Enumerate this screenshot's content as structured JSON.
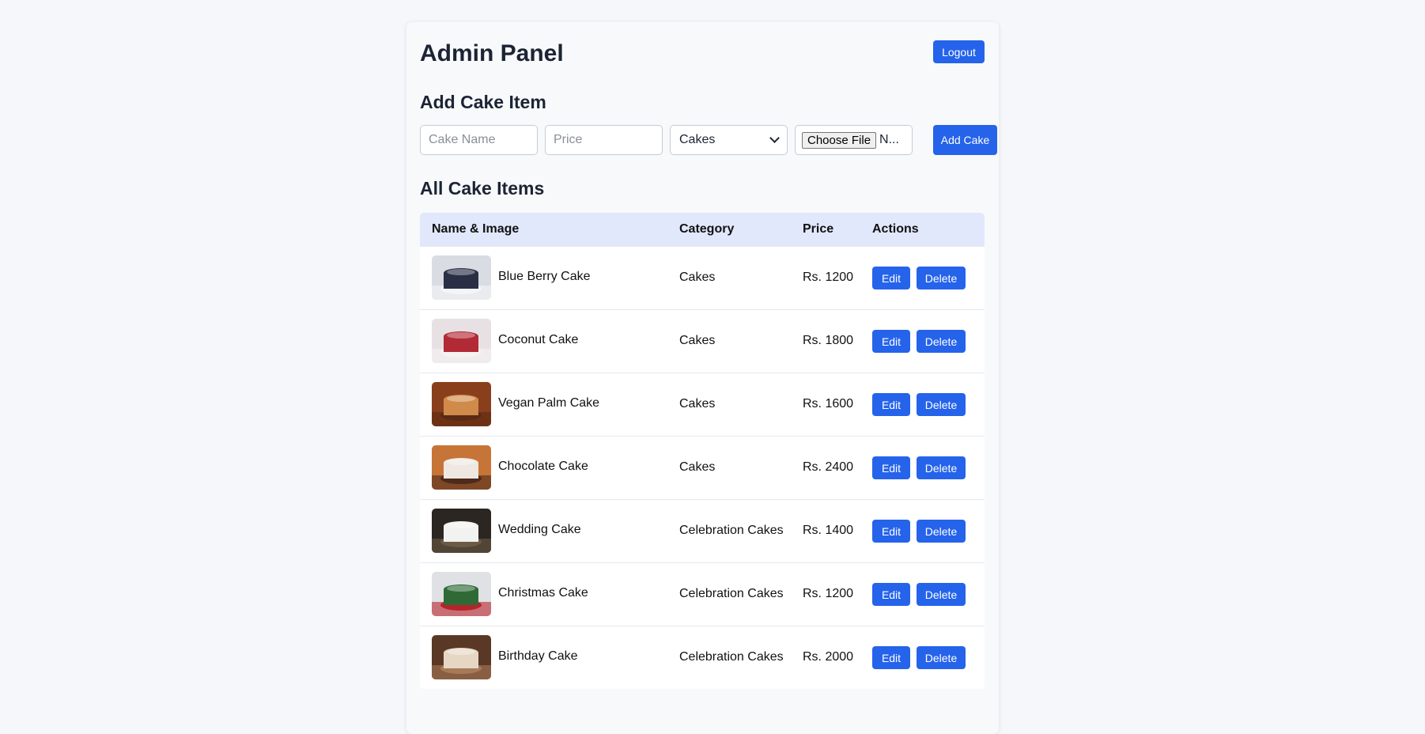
{
  "header": {
    "title": "Admin Panel",
    "logout_label": "Logout"
  },
  "add_form": {
    "title": "Add Cake Item",
    "name_placeholder": "Cake Name",
    "price_placeholder": "Price",
    "category_value": "Cakes",
    "choose_file_label": "Choose File",
    "file_status": "N...",
    "submit_label": "Add Cake"
  },
  "list": {
    "title": "All Cake Items",
    "columns": [
      "Name & Image",
      "Category",
      "Price",
      "Actions"
    ],
    "edit_label": "Edit",
    "delete_label": "Delete",
    "rows": [
      {
        "name": "Blue Berry Cake",
        "category": "Cakes",
        "price": "Rs. 1200",
        "thumb_colors": [
          "#d9dde3",
          "#f4f5f7",
          "#2a2f45"
        ]
      },
      {
        "name": "Coconut Cake",
        "category": "Cakes",
        "price": "Rs. 1800",
        "thumb_colors": [
          "#e7e1e3",
          "#f7f2f1",
          "#b22a35"
        ]
      },
      {
        "name": "Vegan Palm Cake",
        "category": "Cakes",
        "price": "Rs. 1600",
        "thumb_colors": [
          "#8a3f1c",
          "#5a2a12",
          "#d08a4a"
        ]
      },
      {
        "name": "Chocolate Cake",
        "category": "Cakes",
        "price": "Rs. 2400",
        "thumb_colors": [
          "#c77438",
          "#4d2a1a",
          "#efe8e2"
        ]
      },
      {
        "name": "Wedding Cake",
        "category": "Celebration Cakes",
        "price": "Rs. 1400",
        "thumb_colors": [
          "#2b2622",
          "#6b5a44",
          "#f2f2f0"
        ]
      },
      {
        "name": "Christmas Cake",
        "category": "Celebration Cakes",
        "price": "Rs. 1200",
        "thumb_colors": [
          "#dfe1e4",
          "#b8232b",
          "#2f6a36"
        ]
      },
      {
        "name": "Birthday Cake",
        "category": "Celebration Cakes",
        "price": "Rs. 2000",
        "thumb_colors": [
          "#5a3826",
          "#a87a58",
          "#e6d7c4"
        ]
      }
    ]
  },
  "colors": {
    "accent": "#2563eb",
    "table_header_bg": "#e1e8fc"
  }
}
